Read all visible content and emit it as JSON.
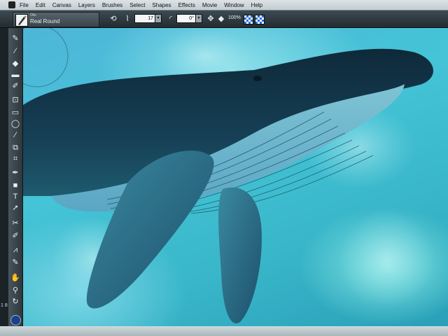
{
  "menubar": {
    "items": [
      "File",
      "Edit",
      "Canvas",
      "Layers",
      "Brushes",
      "Select",
      "Shapes",
      "Effects",
      "Movie",
      "Window",
      "Help"
    ]
  },
  "propbar": {
    "brush_category": "Oils",
    "brush_variant": "Real Round",
    "size_value": "17",
    "angle_value": "0°",
    "zoom_label": "100%"
  },
  "toolbox": {
    "tools": [
      "brush-icon",
      "dropper-icon",
      "paint-bucket-icon",
      "eraser-icon",
      "blender-icon",
      "crop-icon",
      "rectangle-select-icon",
      "lasso-icon",
      "magic-wand-icon",
      "transform-icon",
      "crop-tool-icon",
      "pen-icon",
      "rectangle-shape-icon",
      "text-icon",
      "shape-select-icon",
      "scissors-icon",
      "dodge-icon",
      "mirror-icon",
      "grabber-icon",
      "magnifier-icon",
      "rotate-icon"
    ]
  },
  "side_mark": "1 8",
  "colors": {
    "main_color": "#1b3f8a",
    "canvas_water": "#44c4d6"
  }
}
